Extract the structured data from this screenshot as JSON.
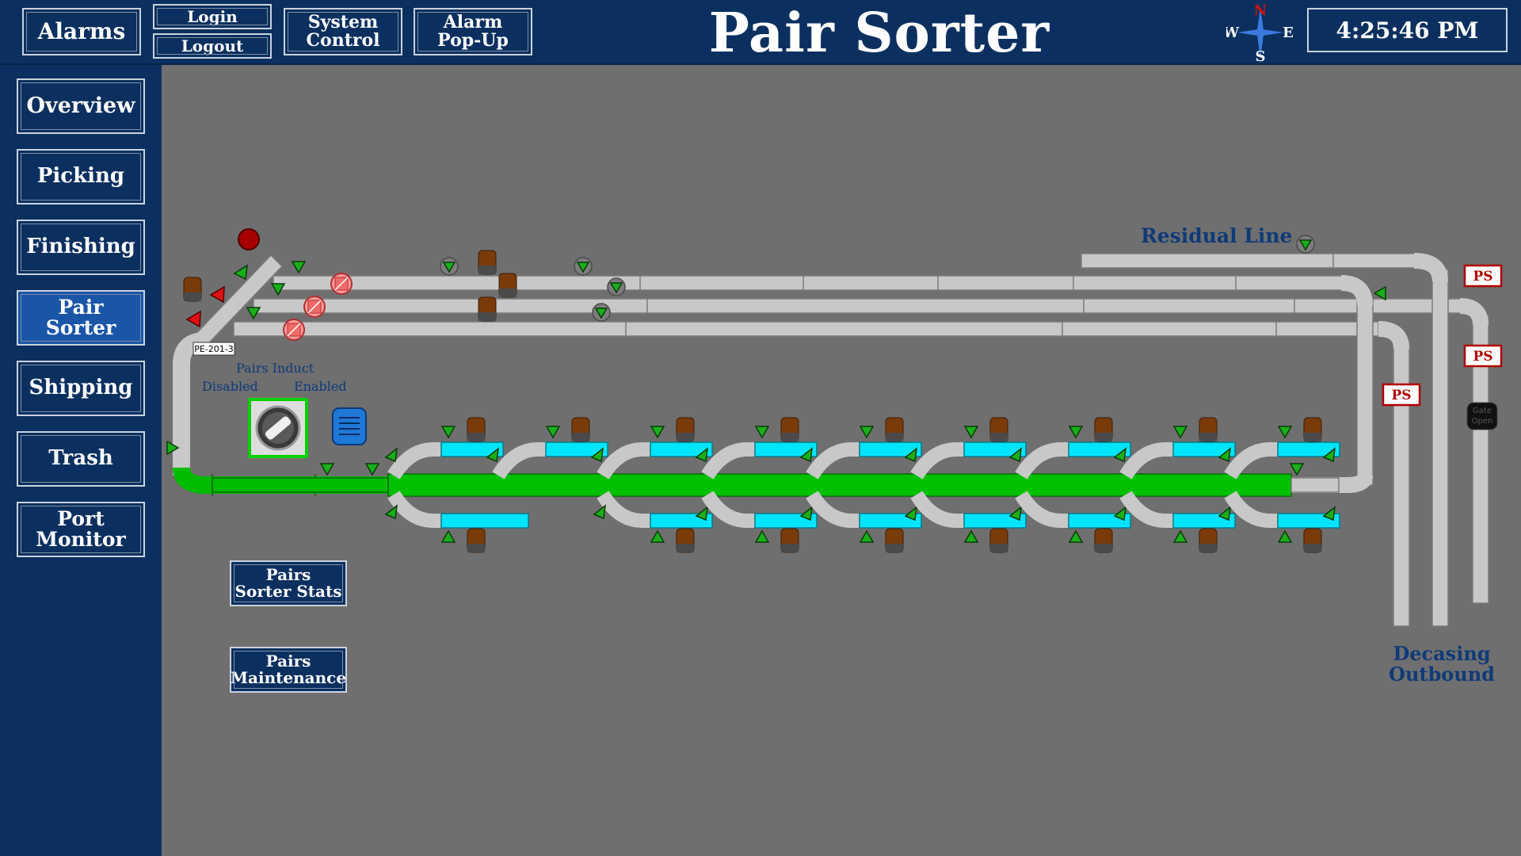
{
  "header": {
    "alarms_label": "Alarms",
    "login_label": "Login",
    "logout_label": "Logout",
    "system_control_label": "System\nControl",
    "alarm_popup_label": "Alarm\nPop-Up",
    "title": "Pair Sorter",
    "clock": "4:25:46 PM",
    "compass": {
      "n": "N",
      "s": "S",
      "e": "E",
      "w": "W"
    }
  },
  "sidebar": {
    "items": [
      {
        "label": "Overview"
      },
      {
        "label": "Picking"
      },
      {
        "label": "Finishing"
      },
      {
        "label": "Pair\nSorter",
        "active": true
      },
      {
        "label": "Shipping"
      },
      {
        "label": "Trash"
      },
      {
        "label": "Port\nMonitor"
      }
    ]
  },
  "main": {
    "residual_line_label": "Residual Line",
    "decasing_outbound_label": "Decasing\nOutbound",
    "induct_title": "Pairs Induct",
    "induct_disabled": "Disabled",
    "induct_enabled": "Enabled",
    "photo_eye_tag": "PE-201-3",
    "ps_label": "PS",
    "gate_label": "Gate\nOpen",
    "sorter_stats_label": "Pairs\nSorter Stats",
    "maintenance_label": "Pairs\nMaintenance"
  },
  "colors": {
    "header_bg": "#0b3060",
    "canvas_bg": "#6f6f6f",
    "conveyor": "#c8c8c8",
    "active_conveyor": "#00bb00",
    "chute": "#00e5ff",
    "label_blue": "#0f3a78",
    "fault_red": "#b00000"
  }
}
